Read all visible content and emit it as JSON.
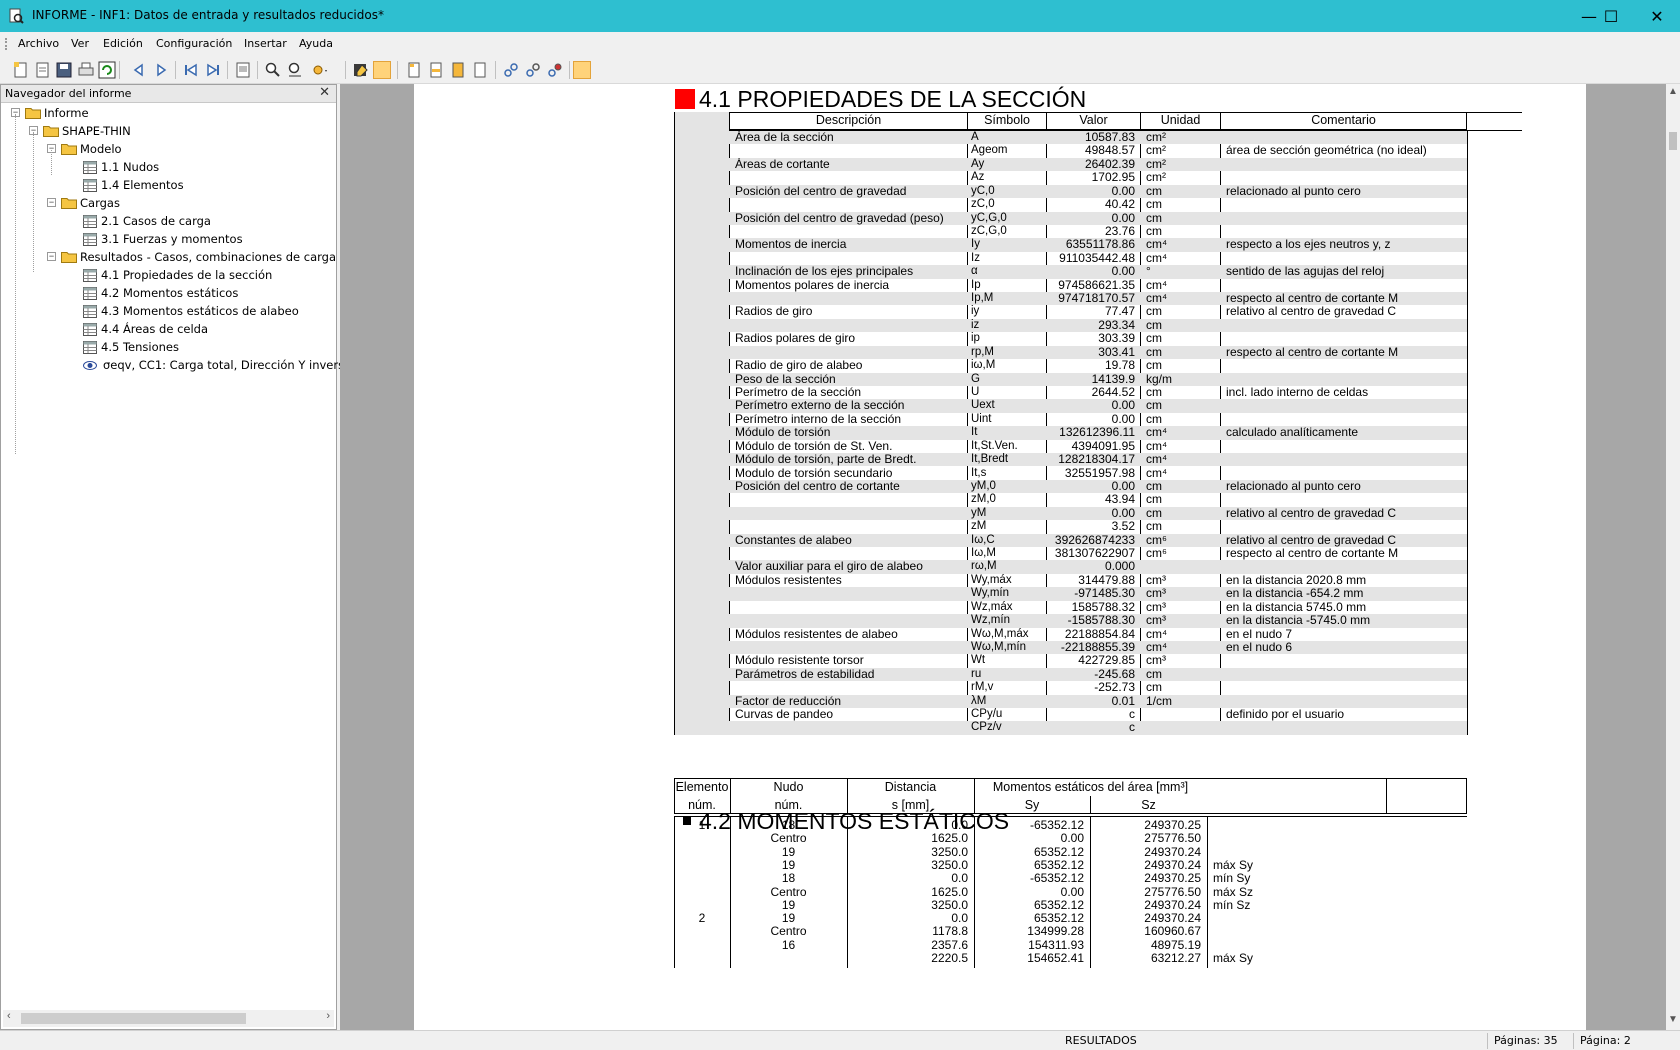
{
  "window": {
    "title": "INFORME - INF1: Datos de entrada y resultados reducidos*",
    "minimize": "—",
    "maximize": "☐",
    "close": "✕"
  },
  "menu": [
    "Archivo",
    "Ver",
    "Edición",
    "Configuración",
    "Insertar",
    "Ayuda"
  ],
  "navigator": {
    "title": "Navegador del informe",
    "close": "✕",
    "tree": [
      {
        "label": "Informe",
        "type": "folder",
        "level": 0
      },
      {
        "label": "SHAPE-THIN",
        "type": "folder",
        "level": 1
      },
      {
        "label": "Modelo",
        "type": "folder",
        "level": 2
      },
      {
        "label": "1.1 Nudos",
        "type": "table",
        "level": 3
      },
      {
        "label": "1.4 Elementos",
        "type": "table",
        "level": 3
      },
      {
        "label": "Cargas",
        "type": "folder",
        "level": 2
      },
      {
        "label": "2.1 Casos de carga",
        "type": "table",
        "level": 3
      },
      {
        "label": "3.1 Fuerzas y momentos",
        "type": "table",
        "level": 3
      },
      {
        "label": "Resultados - Casos, combinaciones de carga",
        "type": "folder",
        "level": 2
      },
      {
        "label": "4.1 Propiedades de la sección",
        "type": "table",
        "level": 3
      },
      {
        "label": "4.2 Momentos estáticos",
        "type": "table",
        "level": 3
      },
      {
        "label": "4.3 Momentos estáticos de alabeo",
        "type": "table",
        "level": 3
      },
      {
        "label": "4.4 Áreas de celda",
        "type": "table",
        "level": 3
      },
      {
        "label": "4.5 Tensiones",
        "type": "table",
        "level": 3
      },
      {
        "label": "σeqv, CC1: Carga total, Dirección Y inversa",
        "type": "eye",
        "level": 3
      }
    ]
  },
  "section41": {
    "title": "4.1 PROPIEDADES DE LA SECCIÓN",
    "headers": [
      "Descripción",
      "Símbolo",
      "Valor",
      "Unidad",
      "Comentario"
    ],
    "rows": [
      [
        "Área de la sección",
        "A",
        "10587.83",
        "cm²",
        ""
      ],
      [
        "",
        "Ageom",
        "49848.57",
        "cm²",
        "área de sección geométrica (no ideal)"
      ],
      [
        "Áreas de cortante",
        "Ay",
        "26402.39",
        "cm²",
        ""
      ],
      [
        "",
        "Az",
        "1702.95",
        "cm²",
        ""
      ],
      [
        "Posición del centro de gravedad",
        "yC,0",
        "0.00",
        "cm",
        "relacionado al punto cero"
      ],
      [
        "",
        "zC,0",
        "40.42",
        "cm",
        ""
      ],
      [
        "Posición del centro de gravedad (peso)",
        "yC,G,0",
        "0.00",
        "cm",
        ""
      ],
      [
        "",
        "zC,G,0",
        "23.76",
        "cm",
        ""
      ],
      [
        "Momentos de inercia",
        "Iy",
        "63551178.86",
        "cm⁴",
        "respecto a los ejes neutros y, z"
      ],
      [
        "",
        "Iz",
        "911035442.48",
        "cm⁴",
        ""
      ],
      [
        "Inclinación de los ejes principales",
        "α",
        "0.00",
        "°",
        "sentido de las agujas del reloj"
      ],
      [
        "Momentos polares de inercia",
        "Ip",
        "974586621.35",
        "cm⁴",
        ""
      ],
      [
        "",
        "Ip,M",
        "974718170.57",
        "cm⁴",
        "respecto al centro de cortante M"
      ],
      [
        "Radios de giro",
        "iy",
        "77.47",
        "cm",
        "relativo al centro de gravedad C"
      ],
      [
        "",
        "iz",
        "293.34",
        "cm",
        ""
      ],
      [
        "Radios polares de giro",
        "ip",
        "303.39",
        "cm",
        ""
      ],
      [
        "",
        "rp,M",
        "303.41",
        "cm",
        "respecto al centro de cortante M"
      ],
      [
        "Radio de giro de alabeo",
        "iω,M",
        "19.78",
        "cm",
        ""
      ],
      [
        "Peso de la sección",
        "G",
        "14139.9",
        "kg/m",
        ""
      ],
      [
        "Perímetro de la sección",
        "U",
        "2644.52",
        "cm",
        "incl. lado interno de celdas"
      ],
      [
        "Perímetro externo de la sección",
        "Uext",
        "0.00",
        "cm",
        ""
      ],
      [
        "Perímetro interno de la sección",
        "Uint",
        "0.00",
        "cm",
        ""
      ],
      [
        "Módulo de torsión",
        "It",
        "132612396.11",
        "cm⁴",
        "calculado analíticamente"
      ],
      [
        "Módulo de torsión de St. Ven.",
        "It,St.Ven.",
        "4394091.95",
        "cm⁴",
        ""
      ],
      [
        "Módulo de torsión, parte de Bredt.",
        "It,Bredt",
        "128218304.17",
        "cm⁴",
        ""
      ],
      [
        "Modulo de torsión secundario",
        "It,s",
        "32551957.98",
        "cm⁴",
        ""
      ],
      [
        "Posición del centro de cortante",
        "yM,0",
        "0.00",
        "cm",
        "relacionado al punto cero"
      ],
      [
        "",
        "zM,0",
        "43.94",
        "cm",
        ""
      ],
      [
        "",
        "yM",
        "0.00",
        "cm",
        "relativo al centro de gravedad C"
      ],
      [
        "",
        "zM",
        "3.52",
        "cm",
        ""
      ],
      [
        "Constantes de alabeo",
        "Iω,C",
        "392626874233",
        "cm⁶",
        "relativo al centro de gravedad C"
      ],
      [
        "",
        "Iω,M",
        "381307622907",
        "cm⁶",
        "respecto al centro de cortante M"
      ],
      [
        "Valor auxiliar para el giro de alabeo",
        "rω,M",
        "0.000",
        "",
        ""
      ],
      [
        "Módulos resistentes",
        "Wy,máx",
        "314479.88",
        "cm³",
        "en la distancia 2020.8 mm"
      ],
      [
        "",
        "Wy,mín",
        "-971485.30",
        "cm³",
        "en la distancia -654.2 mm"
      ],
      [
        "",
        "Wz,máx",
        "1585788.32",
        "cm³",
        "en la distancia 5745.0 mm"
      ],
      [
        "",
        "Wz,mín",
        "-1585788.30",
        "cm³",
        "en la distancia -5745.0 mm"
      ],
      [
        "Módulos resistentes de alabeo",
        "Wω,M,máx",
        "22188854.84",
        "cm⁴",
        "en el nudo 7"
      ],
      [
        "",
        "Wω,M,mín",
        "-22188855.39",
        "cm⁴",
        "en el nudo 6"
      ],
      [
        "Módulo resistente torsor",
        "Wt",
        "422729.85",
        "cm³",
        ""
      ],
      [
        "Parámetros de estabilidad",
        "ru",
        "-245.68",
        "cm",
        ""
      ],
      [
        "",
        "rM,v",
        "-252.73",
        "cm",
        ""
      ],
      [
        "Factor de reducción",
        "λM",
        "0.01",
        "1/cm",
        ""
      ],
      [
        "Curvas de pandeo",
        "CPy/u",
        "c",
        "",
        "definido por el usuario"
      ],
      [
        "",
        "CPz/v",
        "c",
        "",
        ""
      ]
    ]
  },
  "section42": {
    "title": "4.2 MOMENTOS ESTÁTICOS",
    "headers": {
      "elemento": "Elemento",
      "elemento_num": "núm.",
      "nudo": "Nudo",
      "nudo_num": "núm.",
      "distancia": "Distancia",
      "distancia_unit": "s [mm]",
      "momentos": "Momentos estáticos del área [mm³]",
      "sy": "Sy",
      "sz": "Sz"
    },
    "rows": [
      [
        "1",
        "18",
        "0.0",
        "-65352.12",
        "249370.25",
        ""
      ],
      [
        "",
        "Centro",
        "1625.0",
        "0.00",
        "275776.50",
        ""
      ],
      [
        "",
        "19",
        "3250.0",
        "65352.12",
        "249370.24",
        ""
      ],
      [
        "",
        "19",
        "3250.0",
        "65352.12",
        "249370.24",
        "máx Sy"
      ],
      [
        "",
        "18",
        "0.0",
        "-65352.12",
        "249370.25",
        "mín Sy"
      ],
      [
        "",
        "Centro",
        "1625.0",
        "0.00",
        "275776.50",
        "máx Sz"
      ],
      [
        "",
        "19",
        "3250.0",
        "65352.12",
        "249370.24",
        "mín Sz"
      ],
      [
        "2",
        "19",
        "0.0",
        "65352.12",
        "249370.24",
        ""
      ],
      [
        "",
        "Centro",
        "1178.8",
        "134999.28",
        "160960.67",
        ""
      ],
      [
        "",
        "16",
        "2357.6",
        "154311.93",
        "48975.19",
        ""
      ],
      [
        "",
        "",
        "2220.5",
        "154652.41",
        "63212.27",
        "máx Sy"
      ]
    ]
  },
  "status": {
    "mode": "RESULTADOS",
    "pages": "Páginas: 35",
    "page": "Página: 2"
  },
  "colors": {
    "titlebar": "#2ebfd0",
    "section_marker": "#ff0000",
    "row_shade": "#e4e4e4",
    "doc_background": "#a7a7a7"
  }
}
